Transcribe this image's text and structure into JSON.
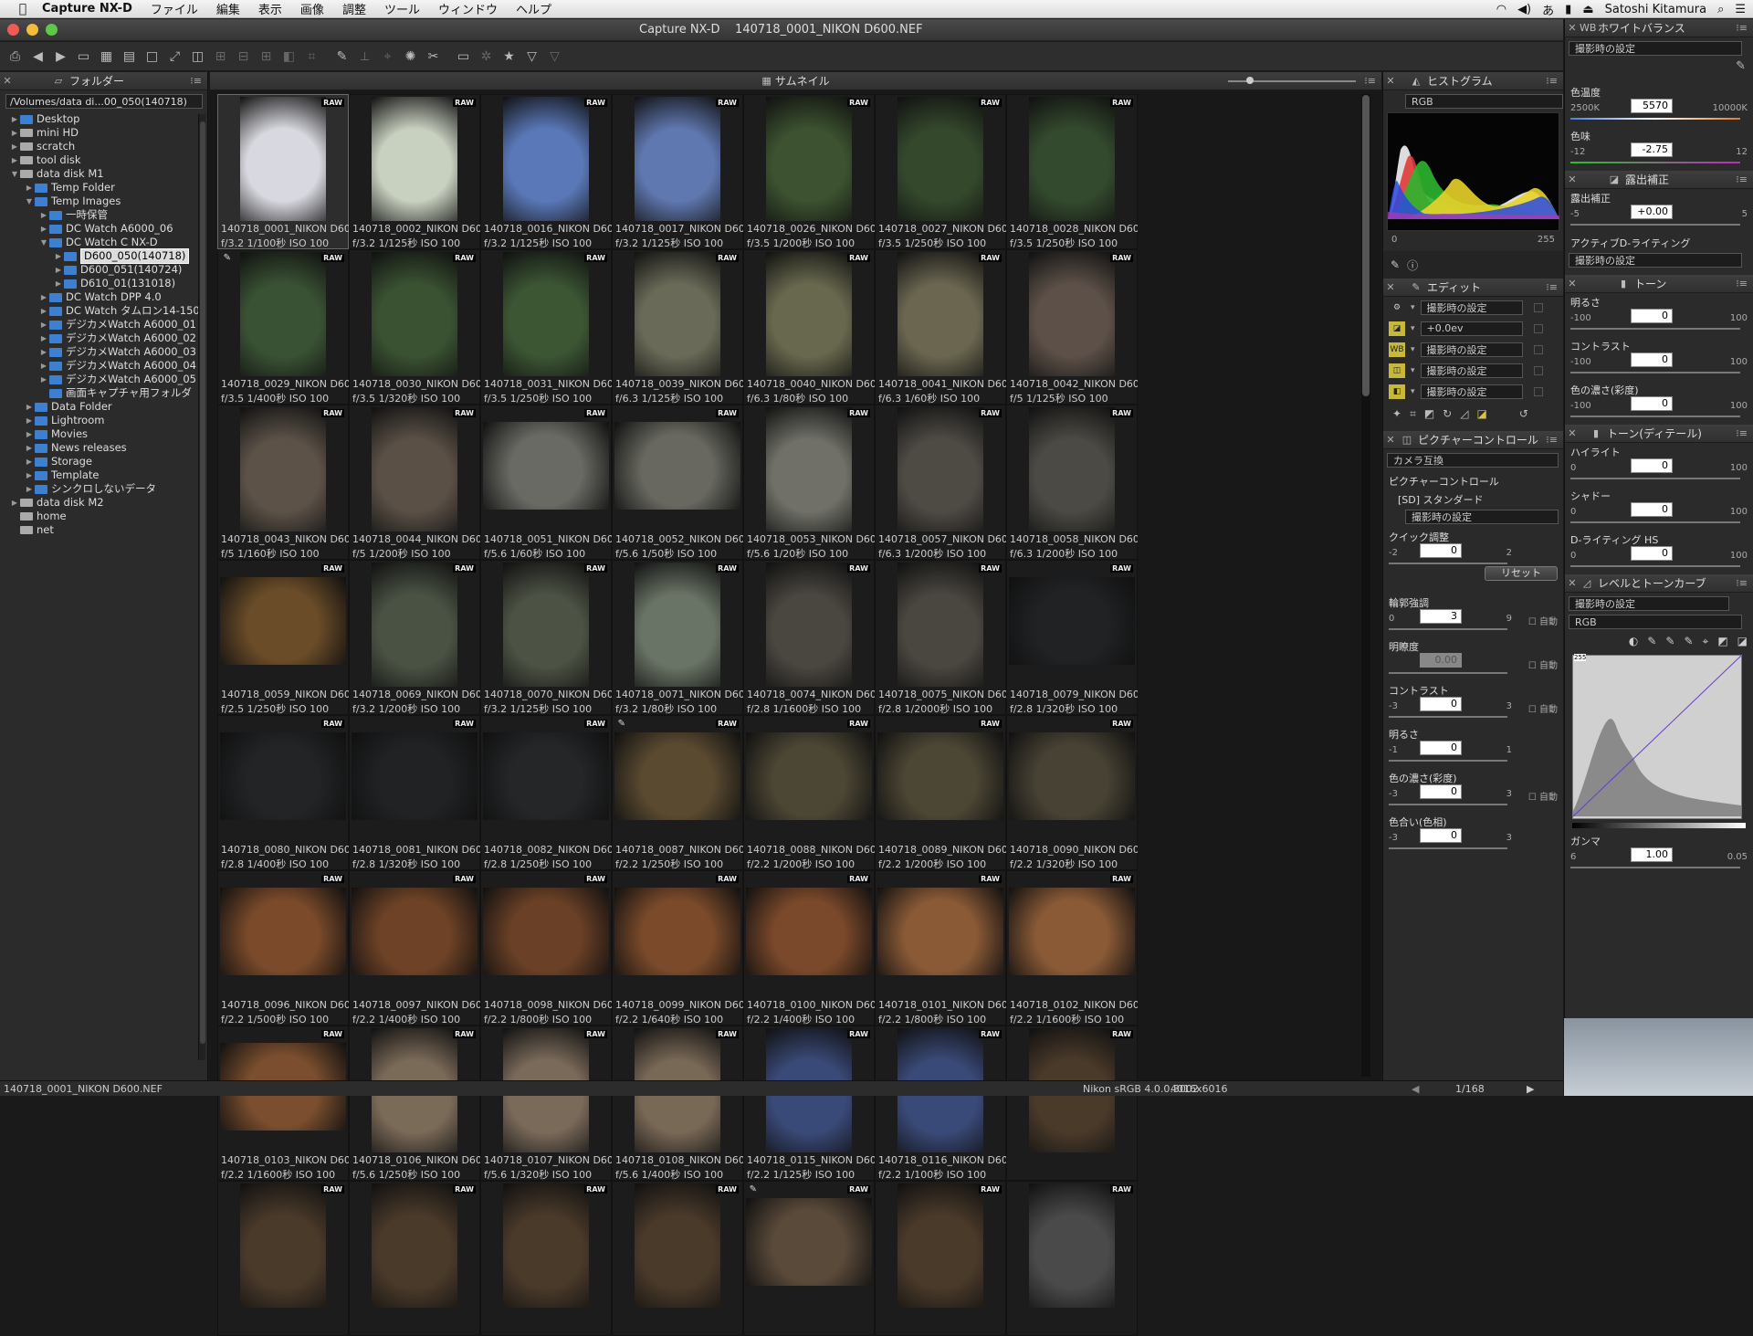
{
  "menubar": {
    "app": "Capture NX-D",
    "items": [
      "ファイル",
      "編集",
      "表示",
      "画像",
      "調整",
      "ツール",
      "ウィンドウ",
      "ヘルプ"
    ],
    "user": "Satoshi Kitamura"
  },
  "window": {
    "title": "Capture NX-D",
    "file": "140718_0001_NIKON D600.NEF"
  },
  "toolbar": {
    "icons": [
      "print-icon",
      "back-icon",
      "forward-icon",
      "open-folder-icon",
      "thumbnail-grid-icon",
      "filmstrip-icon",
      "single-view-icon",
      "full-screen-icon",
      "compare-2-icon",
      "compare-4-icon",
      "compare-v-icon",
      "compare-h-icon",
      "split-icon",
      "crop-icon",
      "eyedropper-icon",
      "straighten-icon",
      "rotate-icon",
      "color-picker-icon",
      "color-control-icon",
      "label-icon",
      "monitor-icon",
      "settings-icon",
      "star-icon",
      "filter-icon",
      "filter-clear-icon"
    ]
  },
  "folder_panel": {
    "title": "フォルダー",
    "path": "/Volumes/data di...00_050(140718)",
    "tree": [
      {
        "d": 0,
        "a": "▶",
        "t": "f",
        "label": "Desktop"
      },
      {
        "d": 0,
        "a": "▶",
        "t": "d",
        "label": "mini HD"
      },
      {
        "d": 0,
        "a": "▶",
        "t": "d",
        "label": "scratch"
      },
      {
        "d": 0,
        "a": "▶",
        "t": "d",
        "label": "tool disk"
      },
      {
        "d": 0,
        "a": "▼",
        "t": "d",
        "label": "data disk M1"
      },
      {
        "d": 1,
        "a": "▶",
        "t": "f",
        "label": "Temp Folder"
      },
      {
        "d": 1,
        "a": "▼",
        "t": "f",
        "label": "Temp Images"
      },
      {
        "d": 2,
        "a": "▶",
        "t": "f",
        "label": "一時保管"
      },
      {
        "d": 2,
        "a": "▶",
        "t": "f",
        "label": "DC Watch A6000_06"
      },
      {
        "d": 2,
        "a": "▼",
        "t": "f",
        "label": "DC Watch C NX-D"
      },
      {
        "d": 3,
        "a": "▶",
        "t": "f",
        "label": "D600_050(140718)",
        "sel": true
      },
      {
        "d": 3,
        "a": "▶",
        "t": "f",
        "label": "D600_051(140724)"
      },
      {
        "d": 3,
        "a": "▶",
        "t": "f",
        "label": "D610_01(131018)"
      },
      {
        "d": 2,
        "a": "▶",
        "t": "f",
        "label": "DC Watch DPP 4.0"
      },
      {
        "d": 2,
        "a": "▶",
        "t": "f",
        "label": "DC Watch タムロン14-150"
      },
      {
        "d": 2,
        "a": "▶",
        "t": "f",
        "label": "デジカメWatch A6000_01"
      },
      {
        "d": 2,
        "a": "▶",
        "t": "f",
        "label": "デジカメWatch A6000_02"
      },
      {
        "d": 2,
        "a": "▶",
        "t": "f",
        "label": "デジカメWatch A6000_03"
      },
      {
        "d": 2,
        "a": "▶",
        "t": "f",
        "label": "デジカメWatch A6000_04"
      },
      {
        "d": 2,
        "a": "▶",
        "t": "f",
        "label": "デジカメWatch A6000_05"
      },
      {
        "d": 2,
        "a": "",
        "t": "f",
        "label": "画面キャプチャ用フォルダ"
      },
      {
        "d": 1,
        "a": "▶",
        "t": "f",
        "label": "Data Folder"
      },
      {
        "d": 1,
        "a": "▶",
        "t": "f",
        "label": "Lightroom"
      },
      {
        "d": 1,
        "a": "▶",
        "t": "f",
        "label": "Movies"
      },
      {
        "d": 1,
        "a": "▶",
        "t": "f",
        "label": "News releases"
      },
      {
        "d": 1,
        "a": "▶",
        "t": "f",
        "label": "Storage"
      },
      {
        "d": 1,
        "a": "▶",
        "t": "f",
        "label": "Template"
      },
      {
        "d": 1,
        "a": "▶",
        "t": "f",
        "label": "シンクロしないデータ"
      },
      {
        "d": 0,
        "a": "▶",
        "t": "d",
        "label": "data disk M2"
      },
      {
        "d": 0,
        "a": "",
        "t": "d",
        "label": "home"
      },
      {
        "d": 0,
        "a": "",
        "t": "d",
        "label": "net"
      }
    ]
  },
  "thumbnail_panel": {
    "title": "サムネイル",
    "raw_badge": "RAW",
    "items": [
      {
        "f": "140718_0001_NIKON D600",
        "e": "f/3.2 1/100秒 ISO 100",
        "c": "#d8d8e0",
        "o": "p",
        "sel": true
      },
      {
        "f": "140718_0002_NIKON D600",
        "e": "f/3.2 1/125秒 ISO 100",
        "c": "#c8d0c0",
        "o": "p"
      },
      {
        "f": "140718_0016_NIKON D600",
        "e": "f/3.2 1/125秒 ISO 100",
        "c": "#5a78b8",
        "o": "p"
      },
      {
        "f": "140718_0017_NIKON D600",
        "e": "f/3.2 1/125秒 ISO 100",
        "c": "#6078b0",
        "o": "p"
      },
      {
        "f": "140718_0026_NIKON D600",
        "e": "f/3.5 1/200秒 ISO 100",
        "c": "#3c5230",
        "o": "p"
      },
      {
        "f": "140718_0027_NIKON D600",
        "e": "f/3.5 1/250秒 ISO 100",
        "c": "#34482c",
        "o": "p"
      },
      {
        "f": "140718_0028_NIKON D600",
        "e": "f/3.5 1/250秒 ISO 100",
        "c": "#344a2e",
        "o": "p"
      },
      {
        "f": "140718_0029_NIKON D600",
        "e": "f/3.5 1/400秒 ISO 100",
        "c": "#3a5234",
        "o": "p",
        "ed": true
      },
      {
        "f": "140718_0030_NIKON D600",
        "e": "f/3.5 1/320秒 ISO 100",
        "c": "#3a5232",
        "o": "p"
      },
      {
        "f": "140718_0031_NIKON D600",
        "e": "f/3.5 1/250秒 ISO 100",
        "c": "#3c5634",
        "o": "p"
      },
      {
        "f": "140718_0039_NIKON D600",
        "e": "f/6.3 1/125秒 ISO 100",
        "c": "#6a6a58",
        "o": "p"
      },
      {
        "f": "140718_0040_NIKON D600",
        "e": "f/6.3 1/80秒 ISO 100",
        "c": "#68684e",
        "o": "p"
      },
      {
        "f": "140718_0041_NIKON D600",
        "e": "f/6.3 1/60秒 ISO 100",
        "c": "#6a6650",
        "o": "p"
      },
      {
        "f": "140718_0042_NIKON D600",
        "e": "f/5 1/125秒 ISO 100",
        "c": "#5c5048",
        "o": "p"
      },
      {
        "f": "140718_0043_NIKON D600",
        "e": "f/5 1/160秒 ISO 100",
        "c": "#5c5248",
        "o": "p"
      },
      {
        "f": "140718_0044_NIKON D600",
        "e": "f/5 1/200秒 ISO 100",
        "c": "#5a5046",
        "o": "p"
      },
      {
        "f": "140718_0051_NIKON D600",
        "e": "f/5.6 1/60秒 ISO 100",
        "c": "#6a6a64",
        "o": "l"
      },
      {
        "f": "140718_0052_NIKON D600",
        "e": "f/5.6 1/50秒 ISO 100",
        "c": "#686860",
        "o": "l"
      },
      {
        "f": "140718_0053_NIKON D600",
        "e": "f/5.6 1/20秒 ISO 100",
        "c": "#707068",
        "o": "p"
      },
      {
        "f": "140718_0057_NIKON D600",
        "e": "f/6.3 1/200秒 ISO 100",
        "c": "#4e4a44",
        "o": "p"
      },
      {
        "f": "140718_0058_NIKON D600",
        "e": "f/6.3 1/200秒 ISO 100",
        "c": "#4c4a44",
        "o": "p"
      },
      {
        "f": "140718_0059_NIKON D600",
        "e": "f/2.5 1/250秒 ISO 100",
        "c": "#6a4c28",
        "o": "l"
      },
      {
        "f": "140718_0069_NIKON D600",
        "e": "f/3.2 1/200秒 ISO 100",
        "c": "#4a5244",
        "o": "p"
      },
      {
        "f": "140718_0070_NIKON D600",
        "e": "f/3.2 1/125秒 ISO 100",
        "c": "#4c5244",
        "o": "p"
      },
      {
        "f": "140718_0071_NIKON D600",
        "e": "f/3.2 1/80秒 ISO 100",
        "c": "#6a7466",
        "o": "p"
      },
      {
        "f": "140718_0074_NIKON D600",
        "e": "f/2.8 1/1600秒 ISO 100",
        "c": "#4a4640",
        "o": "p"
      },
      {
        "f": "140718_0075_NIKON D600",
        "e": "f/2.8 1/2000秒 ISO 100",
        "c": "#4a4640",
        "o": "p"
      },
      {
        "f": "140718_0079_NIKON D600",
        "e": "f/2.8 1/320秒 ISO 100",
        "c": "#202224",
        "o": "l"
      },
      {
        "f": "140718_0080_NIKON D600",
        "e": "f/2.8 1/400秒 ISO 100",
        "c": "#222426",
        "o": "l"
      },
      {
        "f": "140718_0081_NIKON D600",
        "e": "f/2.8 1/320秒 ISO 100",
        "c": "#202224",
        "o": "l"
      },
      {
        "f": "140718_0082_NIKON D600",
        "e": "f/2.8 1/250秒 ISO 100",
        "c": "#242628",
        "o": "l"
      },
      {
        "f": "140718_0087_NIKON D600",
        "e": "f/2.2 1/250秒 ISO 100",
        "c": "#5a4a30",
        "o": "l",
        "ed": true
      },
      {
        "f": "140718_0088_NIKON D600",
        "e": "f/2.2 1/200秒 ISO 100",
        "c": "#4c4634",
        "o": "l"
      },
      {
        "f": "140718_0089_NIKON D600",
        "e": "f/2.2 1/200秒 ISO 100",
        "c": "#4c4634",
        "o": "l"
      },
      {
        "f": "140718_0090_NIKON D600",
        "e": "f/2.2 1/320秒 ISO 100",
        "c": "#484234",
        "o": "l"
      },
      {
        "f": "140718_0096_NIKON D600",
        "e": "f/2.2 1/500秒 ISO 100",
        "c": "#7a4a2a",
        "o": "l"
      },
      {
        "f": "140718_0097_NIKON D600",
        "e": "f/2.2 1/400秒 ISO 100",
        "c": "#6e4226",
        "o": "l"
      },
      {
        "f": "140718_0098_NIKON D600",
        "e": "f/2.2 1/800秒 ISO 100",
        "c": "#6a4026",
        "o": "l"
      },
      {
        "f": "140718_0099_NIKON D600",
        "e": "f/2.2 1/640秒 ISO 100",
        "c": "#7a4a2a",
        "o": "l"
      },
      {
        "f": "140718_0100_NIKON D600",
        "e": "f/2.2 1/400秒 ISO 100",
        "c": "#7a482a",
        "o": "l"
      },
      {
        "f": "140718_0101_NIKON D600",
        "e": "f/2.2 1/800秒 ISO 100",
        "c": "#8a5a36",
        "o": "l"
      },
      {
        "f": "140718_0102_NIKON D600",
        "e": "f/2.2 1/1600秒 ISO 100",
        "c": "#8a5a36",
        "o": "l"
      },
      {
        "f": "140718_0103_NIKON D600",
        "e": "f/2.2 1/1600秒 ISO 100",
        "c": "#7a4e2e",
        "o": "l"
      },
      {
        "f": "140718_0106_NIKON D600",
        "e": "f/5.6 1/250秒 ISO 100",
        "c": "#7a6a58",
        "o": "p"
      },
      {
        "f": "140718_0107_NIKON D600",
        "e": "f/5.6 1/320秒 ISO 100",
        "c": "#7a6a5a",
        "o": "p"
      },
      {
        "f": "140718_0108_NIKON D600",
        "e": "f/5.6 1/400秒 ISO 100",
        "c": "#786856",
        "o": "p"
      },
      {
        "f": "140718_0115_NIKON D600",
        "e": "f/2.2 1/125秒 ISO 100",
        "c": "#3a4a78",
        "o": "p"
      },
      {
        "f": "140718_0116_NIKON D600",
        "e": "f/2.2 1/100秒 ISO 100",
        "c": "#3a4a78",
        "o": "p"
      },
      {
        "f": "",
        "e": "",
        "c": "#4a3a2a",
        "o": "p"
      },
      {
        "f": "",
        "e": "",
        "c": "#4a3a2a",
        "o": "p"
      },
      {
        "f": "",
        "e": "",
        "c": "#4a3a2a",
        "o": "p"
      },
      {
        "f": "",
        "e": "",
        "c": "#4a3a2a",
        "o": "p"
      },
      {
        "f": "",
        "e": "",
        "c": "#4a3a2a",
        "o": "p"
      },
      {
        "f": "",
        "e": "",
        "c": "#5a4a3a",
        "o": "l",
        "ed": true
      },
      {
        "f": "",
        "e": "",
        "c": "#4a3a2a",
        "o": "p"
      },
      {
        "f": "",
        "e": "",
        "c": "#4a4a4a",
        "o": "p"
      }
    ]
  },
  "histogram": {
    "title": "ヒストグラム",
    "channel": "RGB",
    "min": "0",
    "max": "255"
  },
  "edit_panel": {
    "title": "エディット",
    "rows": [
      "撮影時の設定",
      "+0.0ev",
      "撮影時の設定",
      "撮影時の設定",
      "撮影時の設定"
    ],
    "row_icons": [
      "gear-icon",
      "exposure-icon",
      "wb-icon",
      "picture-control-icon",
      "tone-icon"
    ]
  },
  "picture_control": {
    "title": "ピクチャーコントロール",
    "mode": "カメラ互換",
    "label": "ピクチャーコントロール",
    "preset": "[SD] スタンダード",
    "setting": "撮影時の設定",
    "reset": "リセット",
    "sliders": [
      {
        "name": "クイック調整",
        "min": "-2",
        "max": "2",
        "val": "0",
        "auto": ""
      },
      {
        "name": "輪郭強調",
        "min": "0",
        "max": "9",
        "val": "3",
        "auto": "自動"
      },
      {
        "name": "明瞭度",
        "min": "",
        "max": "",
        "val": "0.00",
        "auto": "自動",
        "dis": true
      },
      {
        "name": "コントラスト",
        "min": "-3",
        "max": "3",
        "val": "0",
        "auto": "自動"
      },
      {
        "name": "明るさ",
        "min": "-1",
        "max": "1",
        "val": "0",
        "auto": ""
      },
      {
        "name": "色の濃さ(彩度)",
        "min": "-3",
        "max": "3",
        "val": "0",
        "auto": "自動"
      },
      {
        "name": "色合い(色相)",
        "min": "-3",
        "max": "3",
        "val": "0",
        "auto": ""
      }
    ]
  },
  "white_balance": {
    "title": "ホワイトバランス",
    "setting": "撮影時の設定",
    "temp_label": "色温度",
    "temp_min": "2500K",
    "temp_max": "10000K",
    "temp_val": "5570",
    "tint_label": "色味",
    "tint_min": "-12",
    "tint_max": "12",
    "tint_val": "-2.75"
  },
  "exposure": {
    "title": "露出補正",
    "label": "露出補正",
    "min": "-5",
    "max": "5",
    "val": "+0.00",
    "adl_label": "アクティブD-ライティング",
    "adl_val": "撮影時の設定"
  },
  "tone": {
    "title": "トーン",
    "sliders": [
      {
        "name": "明るさ",
        "min": "-100",
        "max": "100",
        "val": "0"
      },
      {
        "name": "コントラスト",
        "min": "-100",
        "max": "100",
        "val": "0"
      },
      {
        "name": "色の濃さ(彩度)",
        "min": "-100",
        "max": "100",
        "val": "0"
      }
    ]
  },
  "tone_detail": {
    "title": "トーン(ディテール)",
    "sliders": [
      {
        "name": "ハイライト",
        "min": "0",
        "max": "100",
        "val": "0"
      },
      {
        "name": "シャドー",
        "min": "0",
        "max": "100",
        "val": "0"
      },
      {
        "name": "D-ライティング HS",
        "min": "0",
        "max": "100",
        "val": "0"
      }
    ]
  },
  "levels": {
    "title": "レベルとトーンカーブ",
    "setting": "撮影時の設定",
    "channel": "RGB",
    "top_label": "255",
    "gamma_label": "ガンマ",
    "gamma_min": "6",
    "gamma_max": "0.05",
    "gamma_val": "1.00"
  },
  "status": {
    "file": "140718_0001_NIKON D600.NEF",
    "profile": "Nikon sRGB 4.0.0.3002",
    "size": "4016x6016",
    "page": "1/168"
  }
}
